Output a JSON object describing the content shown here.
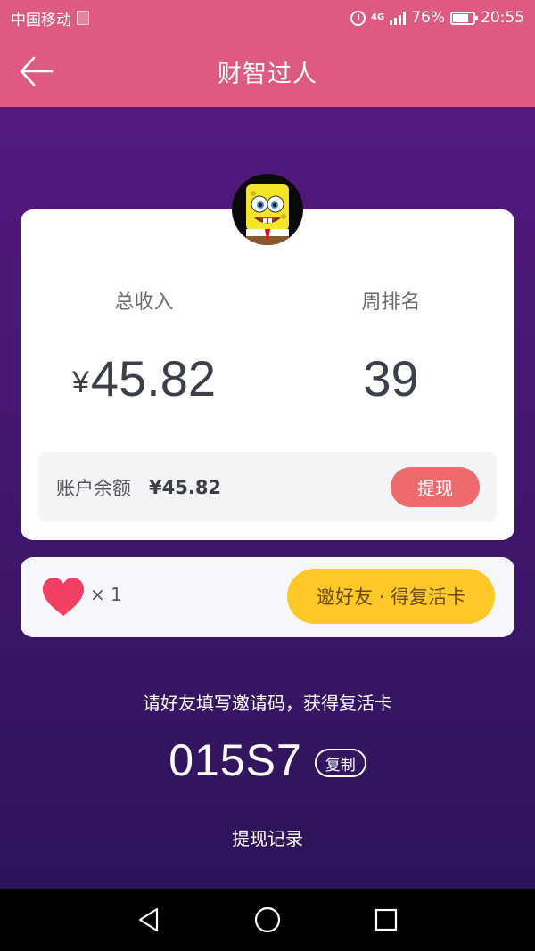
{
  "status_bar": {
    "carrier": "中国移动",
    "network": "4G",
    "battery": "76%",
    "time": "20:55"
  },
  "header": {
    "title": "财智过人"
  },
  "stats": {
    "total_income_label": "总收入",
    "total_income_currency": "¥",
    "total_income_value": "45.82",
    "weekly_rank_label": "周排名",
    "weekly_rank_value": "39"
  },
  "balance": {
    "label": "账户余额",
    "value": "¥45.82",
    "withdraw_label": "提现"
  },
  "lives": {
    "count": "× 1",
    "invite_button_label": "邀好友 · 得复活卡"
  },
  "invite": {
    "hint": "请好友填写邀请码，获得复活卡",
    "code": "015S7",
    "copy_label": "复制"
  },
  "footer": {
    "history_label": "提现记录"
  },
  "colors": {
    "header_pink": "#df5a80",
    "bg_purple_top": "#54197f",
    "bg_purple_bottom": "#2c1459",
    "withdraw_red": "#ee6a6c",
    "invite_yellow": "#fec928",
    "heart_pink": "#f43f65"
  }
}
